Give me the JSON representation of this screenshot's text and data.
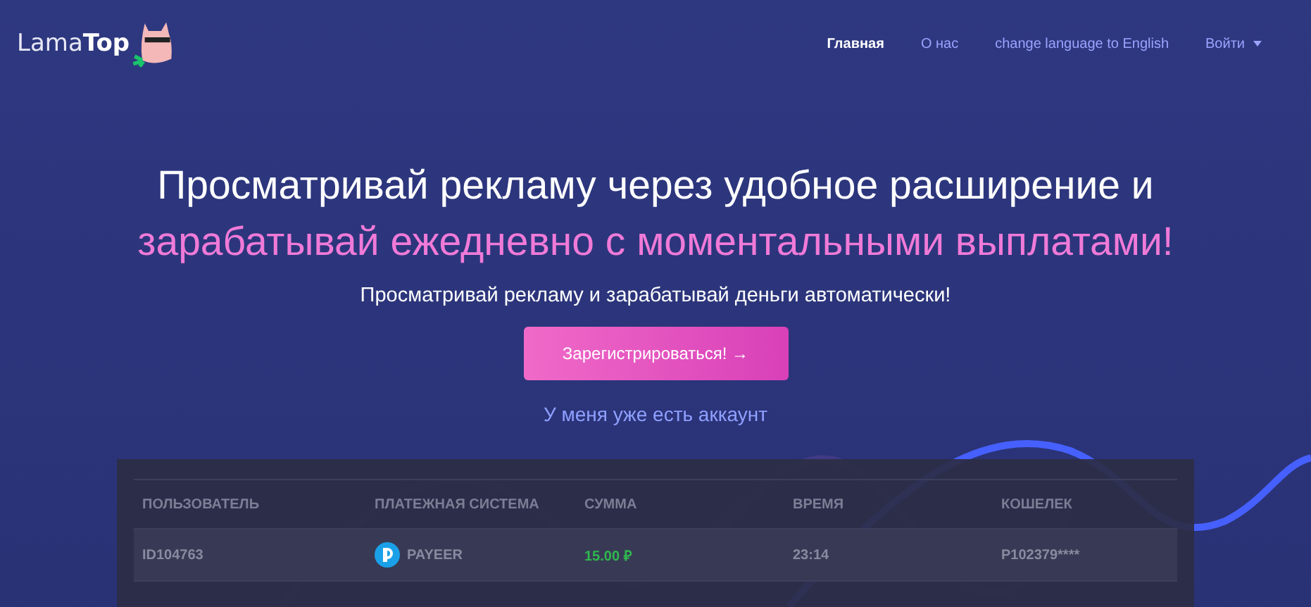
{
  "logo": {
    "text_light": "Lama",
    "text_bold": "Top"
  },
  "nav": [
    {
      "label": "Главная",
      "selected": true
    },
    {
      "label": "О нас",
      "selected": false
    },
    {
      "label": "change language to English",
      "selected": false
    },
    {
      "label": "Войти",
      "selected": false,
      "kind": "dropdown"
    }
  ],
  "hero": {
    "headline": "Просматривай рекламу через удобное расширение и ",
    "headline_accent": "зарабатывай ежедневно с моментальными выплатами!",
    "subtitle": "Просматривай рекламу и зарабатывай деньги автоматически!",
    "cta": "Зарегистрироваться! →",
    "login_link": "У меня уже есть аккаунт"
  },
  "table": {
    "columns": [
      "ПОЛЬЗОВАТЕЛЬ",
      "ПЛАТЕЖНАЯ СИСТЕМА",
      "СУММА",
      "ВРЕМЯ",
      "КОШЕЛЕК"
    ],
    "rows": [
      {
        "user": "ID104763",
        "system": "PAYEER",
        "amount": "15.00 ₽",
        "time": "23:14",
        "wallet": "P102379****",
        "selected": true
      }
    ]
  }
}
